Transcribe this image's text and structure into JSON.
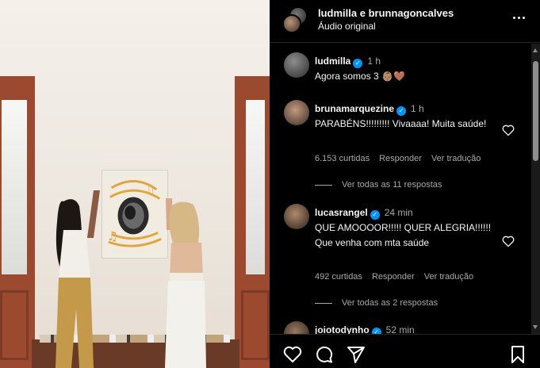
{
  "header": {
    "title": "ludmilla e brunnagoncalves",
    "subtitle": "Áudio original"
  },
  "comments": [
    {
      "user": "ludmilla",
      "verified": true,
      "time": "1 h",
      "text": "Agora somos 3 👶🏽🤎"
    },
    {
      "user": "brunamarquezine",
      "verified": true,
      "time": "1 h",
      "text": "PARABÉNS!!!!!!!!! Vivaaaa! Muita saúde!",
      "likes": "6.153 curtidas",
      "reply_label": "Responder",
      "translate_label": "Ver tradução",
      "view_replies": "Ver todas as 11 respostas"
    },
    {
      "user": "lucasrangel",
      "verified": true,
      "time": "24 min",
      "text": "QUE AMOOOOR!!!!! QUER ALEGRIA!!!!!! Que venha com mta saúde",
      "likes": "492 curtidas",
      "reply_label": "Responder",
      "translate_label": "Ver tradução",
      "view_replies": "Ver todas as 2 respostas"
    },
    {
      "user": "joiotodynho",
      "verified": true,
      "time": "52 min",
      "text": ""
    }
  ],
  "icons": {
    "header_more": "more-horizontal-icon",
    "like": "heart-icon",
    "comment": "comment-icon",
    "share": "send-icon",
    "save": "bookmark-icon",
    "verified": "verified-badge-icon"
  },
  "colors": {
    "background": "#000000",
    "text": "#f5f5f5",
    "muted": "#a8a8a8",
    "verified": "#0095f6"
  }
}
